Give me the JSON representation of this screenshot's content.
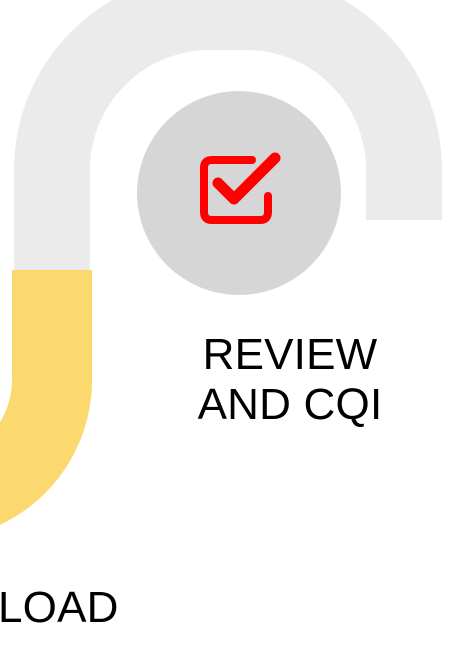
{
  "colors": {
    "track_gray": "#ebebeb",
    "track_yellow": "#fcd96e",
    "circle_fill": "#d6d6d6",
    "icon_red": "#ff0000",
    "text": "#000000",
    "background": "#ffffff"
  },
  "step": {
    "icon": "checkbox-checked-icon",
    "label_line1": "REVIEW",
    "label_line2": "AND CQI"
  },
  "partial_step": {
    "label_fragment": "LOAD"
  }
}
